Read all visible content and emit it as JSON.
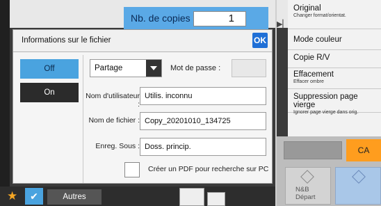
{
  "background": {
    "copies_label": "Nb. de copies",
    "copies_value": "1",
    "right_panel": {
      "items": [
        {
          "title": "Original",
          "subtitle": "Changer format/orientat."
        },
        {
          "title": "Mode couleur",
          "subtitle": ""
        },
        {
          "title": "Copie R/V",
          "subtitle": ""
        },
        {
          "title": "Effacement",
          "subtitle": "Effacer ombre"
        },
        {
          "title": "Suppression page vierge",
          "subtitle": "Ignorer page vierge dans orig."
        }
      ]
    },
    "ca_label": "CA",
    "nb_start_label_1": "N&B",
    "nb_start_label_2": "Départ",
    "autres_label": "Autres"
  },
  "dialog": {
    "title": "Informations sur le fichier",
    "ok_label": "OK",
    "toggle_off_label": "Off",
    "toggle_on_label": "On",
    "share_select_value": "Partage",
    "password_label": "Mot de passe :",
    "username_label": "Nom d'utilisateur :",
    "username_value": "Utilis. inconnu",
    "filename_label": "Nom de fichier :",
    "filename_value": "Copy_20201010_134725",
    "save_label": "Enreg. Sous :",
    "save_value": "Doss. princip.",
    "pdf_checkbox_label": "Créer un PDF pour recherche sur PC"
  },
  "colors": {
    "accent_blue": "#4aa3df",
    "ok_blue": "#1f6fd6",
    "ca_orange": "#ff9d1e"
  }
}
